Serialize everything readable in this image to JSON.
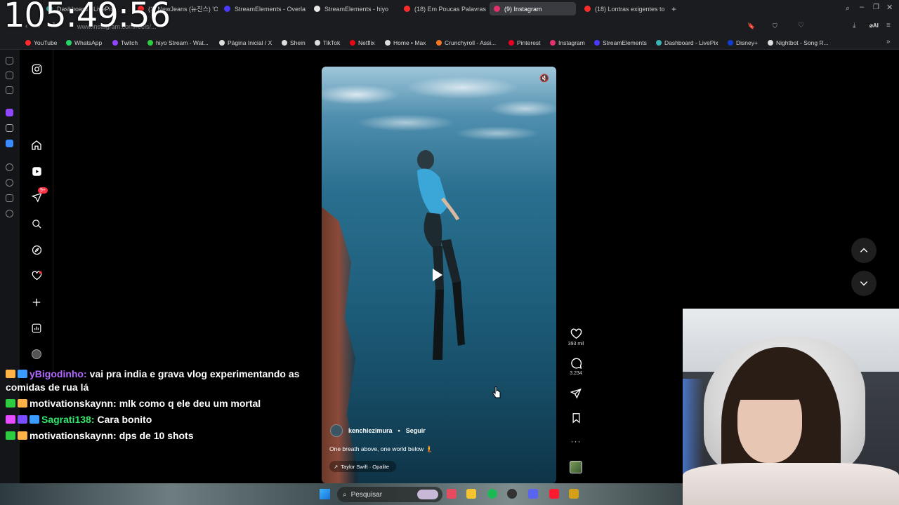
{
  "clock": "105:49:56",
  "browser": {
    "tabs": [
      {
        "label": "Dashboard - LivePix",
        "color": "#3ab3b3"
      },
      {
        "label": "(1) NewJeans (뉴진스) 'O",
        "color": "#ff2b2b"
      },
      {
        "label": "StreamElements - Overla",
        "color": "#4a3aff"
      },
      {
        "label": "StreamElements - hiyo",
        "color": "#e8e8e8"
      },
      {
        "label": "(18) Em Poucas Palavras",
        "color": "#ff2b2b"
      },
      {
        "label": "(9) Instagram",
        "color": "#e1306c",
        "active": true
      },
      {
        "label": "(18) Lontras exigentes ton",
        "color": "#ff2b2b"
      }
    ],
    "new_tab": "+",
    "url": "www.instagram.com/reels/...",
    "bookmarks": [
      {
        "label": "YouTube",
        "color": "#ff2b2b"
      },
      {
        "label": "WhatsApp",
        "color": "#25d366"
      },
      {
        "label": "Twitch",
        "color": "#9146ff"
      },
      {
        "label": "hiyo Stream - Wat...",
        "color": "#2ecc40"
      },
      {
        "label": "Página Inicial / X",
        "color": "#dddddd"
      },
      {
        "label": "Shein",
        "color": "#dddddd"
      },
      {
        "label": "TikTok",
        "color": "#dddddd"
      },
      {
        "label": "Netflix",
        "color": "#e50914"
      },
      {
        "label": "Home • Max",
        "color": "#dddddd"
      },
      {
        "label": "Crunchyroll - Assi...",
        "color": "#f47521"
      },
      {
        "label": "Pinterest",
        "color": "#e60023"
      },
      {
        "label": "Instagram",
        "color": "#e1306c"
      },
      {
        "label": "StreamElements",
        "color": "#4a3aff"
      },
      {
        "label": "Dashboard - LivePix",
        "color": "#3ab3b3"
      },
      {
        "label": "Disney+",
        "color": "#113ccf"
      },
      {
        "label": "Nightbot - Song R...",
        "color": "#dddddd"
      }
    ]
  },
  "instagram": {
    "notification_badge": "9+",
    "reel": {
      "username": "kenchiezimura",
      "separator": "•",
      "follow": "Seguir",
      "caption": "One breath above, one world below 🧜",
      "audio": "Taylor Swift · Opalite"
    },
    "actions": {
      "likes": "393 mil",
      "comments": "3.234"
    }
  },
  "chat": [
    {
      "user": "yBigodinho:",
      "text": "vai pra india e grava vlog experimentando as comidas de rua lá",
      "color": "#b36bff"
    },
    {
      "user": "motivationskaynn:",
      "text": "mlk como q ele deu um mortal",
      "color": "#ffffff"
    },
    {
      "user": "Sagrati138:",
      "text": "Cara bonito",
      "color": "#2ee86b"
    },
    {
      "user": "motivationskaynn:",
      "text": "dps de 10 shots",
      "color": "#ffffff"
    }
  ],
  "taskbar": {
    "search_placeholder": "Pesquisar"
  }
}
